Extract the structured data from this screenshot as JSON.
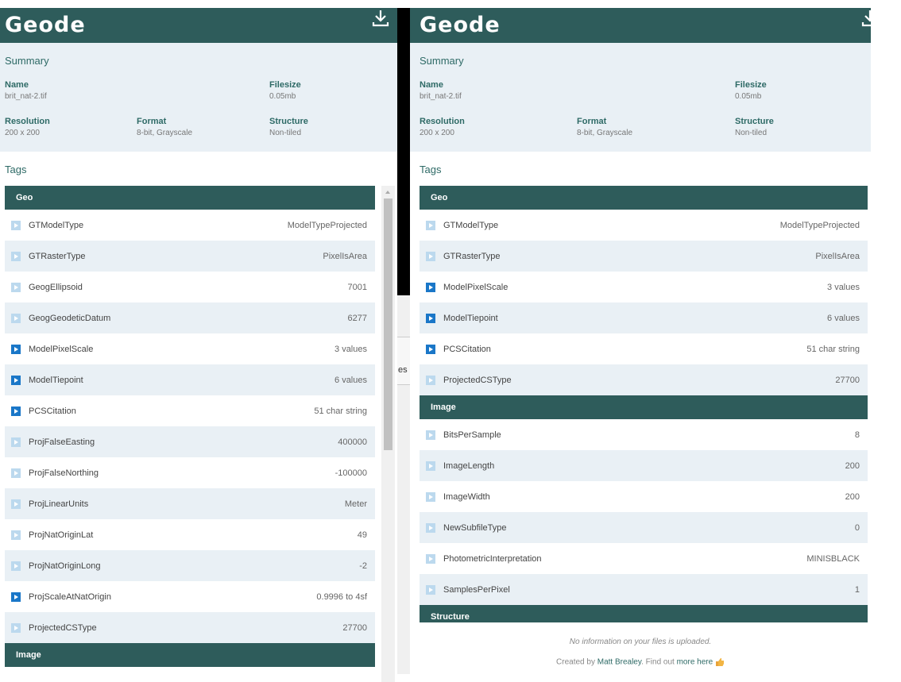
{
  "app_title": "Geode",
  "summary": {
    "title": "Summary",
    "name_label": "Name",
    "name_value": "brit_nat-2.tif",
    "filesize_label": "Filesize",
    "filesize_value": "0.05mb",
    "resolution_label": "Resolution",
    "resolution_value": "200 x 200",
    "format_label": "Format",
    "format_value": "8-bit, Grayscale",
    "structure_label": "Structure",
    "structure_value": "Non-tiled"
  },
  "tags_title": "Tags",
  "left": {
    "sections": [
      {
        "title": "Geo",
        "rows": [
          {
            "name": "GTModelType",
            "value": "ModelTypeProjected",
            "expandable": false
          },
          {
            "name": "GTRasterType",
            "value": "PixelIsArea",
            "expandable": false
          },
          {
            "name": "GeogEllipsoid",
            "value": "7001",
            "expandable": false
          },
          {
            "name": "GeogGeodeticDatum",
            "value": "6277",
            "expandable": false
          },
          {
            "name": "ModelPixelScale",
            "value": "3 values",
            "expandable": true
          },
          {
            "name": "ModelTiepoint",
            "value": "6 values",
            "expandable": true
          },
          {
            "name": "PCSCitation",
            "value": "51 char string",
            "expandable": true
          },
          {
            "name": "ProjFalseEasting",
            "value": "400000",
            "expandable": false
          },
          {
            "name": "ProjFalseNorthing",
            "value": "-100000",
            "expandable": false
          },
          {
            "name": "ProjLinearUnits",
            "value": "Meter",
            "expandable": false
          },
          {
            "name": "ProjNatOriginLat",
            "value": "49",
            "expandable": false
          },
          {
            "name": "ProjNatOriginLong",
            "value": "-2",
            "expandable": false
          },
          {
            "name": "ProjScaleAtNatOrigin",
            "value": "0.9996 to 4sf",
            "expandable": true
          },
          {
            "name": "ProjectedCSType",
            "value": "27700",
            "expandable": false
          }
        ]
      },
      {
        "title": "Image",
        "rows": []
      }
    ]
  },
  "right": {
    "sections": [
      {
        "title": "Geo",
        "rows": [
          {
            "name": "GTModelType",
            "value": "ModelTypeProjected",
            "expandable": false
          },
          {
            "name": "GTRasterType",
            "value": "PixelIsArea",
            "expandable": false
          },
          {
            "name": "ModelPixelScale",
            "value": "3 values",
            "expandable": true
          },
          {
            "name": "ModelTiepoint",
            "value": "6 values",
            "expandable": true
          },
          {
            "name": "PCSCitation",
            "value": "51 char string",
            "expandable": true
          },
          {
            "name": "ProjectedCSType",
            "value": "27700",
            "expandable": false
          }
        ]
      },
      {
        "title": "Image",
        "rows": [
          {
            "name": "BitsPerSample",
            "value": "8",
            "expandable": false
          },
          {
            "name": "ImageLength",
            "value": "200",
            "expandable": false
          },
          {
            "name": "ImageWidth",
            "value": "200",
            "expandable": false
          },
          {
            "name": "NewSubfileType",
            "value": "0",
            "expandable": false
          },
          {
            "name": "PhotometricInterpretation",
            "value": "MINISBLACK",
            "expandable": false
          },
          {
            "name": "SamplesPerPixel",
            "value": "1",
            "expandable": false
          }
        ]
      },
      {
        "title": "Structure",
        "rows": []
      }
    ]
  },
  "footer": {
    "note": "No information on your files is uploaded.",
    "credit_prefix": "Created by ",
    "author": "Matt Brealey",
    "credit_middle": ". Find out ",
    "more_link": "more here"
  },
  "divider_fragment": "es",
  "colors": {
    "header": "#2e5c5b",
    "summary_bg": "#e9f0f5",
    "accent_text": "#2e6a66",
    "icon_active": "#1a77c8",
    "icon_inactive": "#bcd9ee"
  },
  "icons": {
    "download": "download-icon",
    "expand": "expand-arrow-icon",
    "thumbs_up": "thumbs-up-icon"
  }
}
